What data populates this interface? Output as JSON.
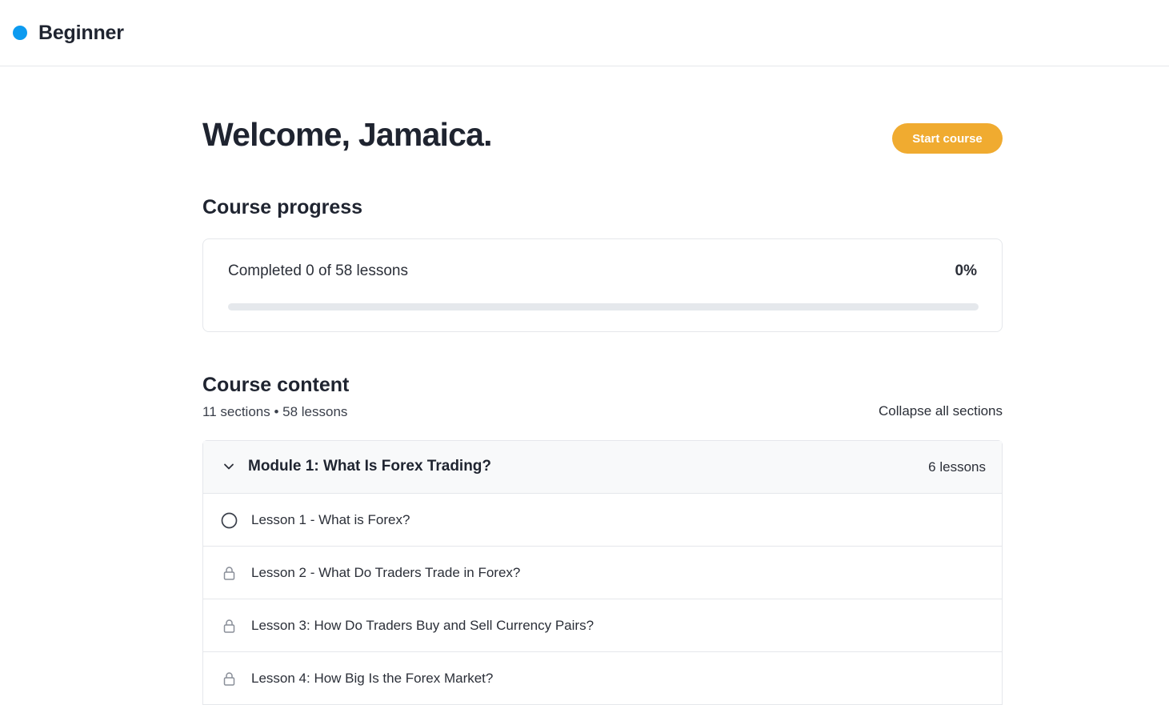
{
  "header": {
    "title": "Beginner",
    "accent_color": "#0d9bf0"
  },
  "welcome": {
    "heading": "Welcome, Jamaica.",
    "start_button": "Start course",
    "button_color": "#f0ab30"
  },
  "progress": {
    "title": "Course progress",
    "summary": "Completed 0 of 58 lessons",
    "percent_label": "0%",
    "percent_value": 0
  },
  "content": {
    "title": "Course content",
    "meta": "11 sections • 58 lessons",
    "collapse_label": "Collapse all sections",
    "modules": [
      {
        "title": "Module 1: What Is Forex Trading?",
        "count": "6 lessons",
        "expanded": true,
        "lessons": [
          {
            "label": "Lesson 1 - What is Forex?",
            "icon": "circle-icon"
          },
          {
            "label": "Lesson 2 - What Do Traders Trade in Forex?",
            "icon": "lock-icon"
          },
          {
            "label": "Lesson 3: How Do Traders Buy and Sell Currency Pairs?",
            "icon": "lock-icon"
          },
          {
            "label": "Lesson 4: How Big Is the Forex Market?",
            "icon": "lock-icon"
          }
        ]
      }
    ]
  }
}
